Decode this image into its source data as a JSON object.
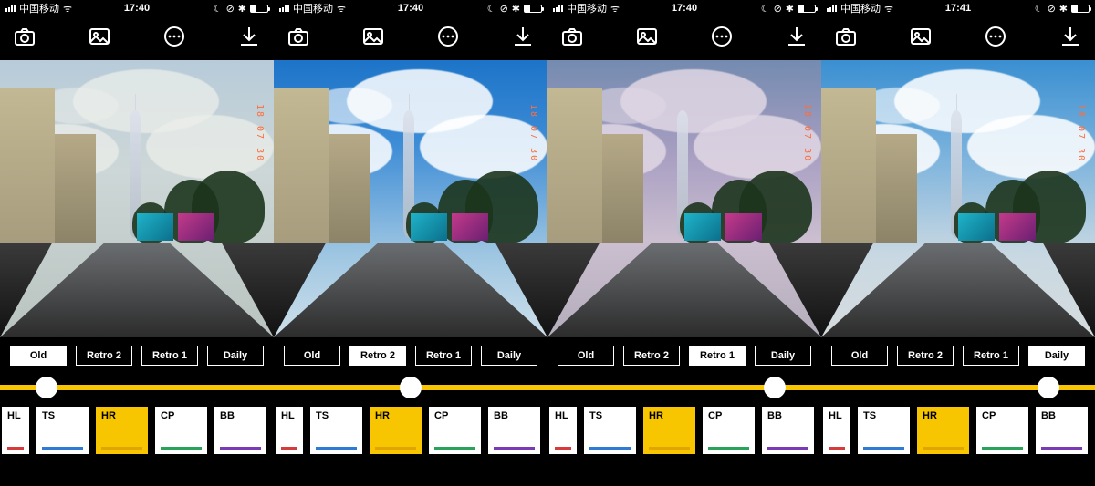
{
  "status_icons": {
    "moon": "☾",
    "alarm": "⊘",
    "bt": "✱",
    "carrier_wifi": "ᯤ"
  },
  "date_stamp": "18 07 30",
  "effects": [
    {
      "code": "HL",
      "color": "#d73a3a"
    },
    {
      "code": "TS",
      "color": "#2e7bd6"
    },
    {
      "code": "HR",
      "color": "#e0a500"
    },
    {
      "code": "CP",
      "color": "#2aa35a"
    },
    {
      "code": "BB",
      "color": "#7a3ab5"
    }
  ],
  "presets": [
    "Old",
    "Retro 2",
    "Retro 1",
    "Daily"
  ],
  "screens": [
    {
      "time": "17:40",
      "carrier": "中国移动",
      "active_preset": "Old",
      "slider_pos": 0.17,
      "selected_fx": "HR"
    },
    {
      "time": "17:40",
      "carrier": "中国移动",
      "active_preset": "Retro 2",
      "slider_pos": 0.5,
      "selected_fx": "HR"
    },
    {
      "time": "17:40",
      "carrier": "中国移动",
      "active_preset": "Retro 1",
      "slider_pos": 0.83,
      "selected_fx": "HR"
    },
    {
      "time": "17:41",
      "carrier": "中国移动",
      "active_preset": "Daily",
      "slider_pos": 0.83,
      "selected_fx": "HR"
    }
  ]
}
